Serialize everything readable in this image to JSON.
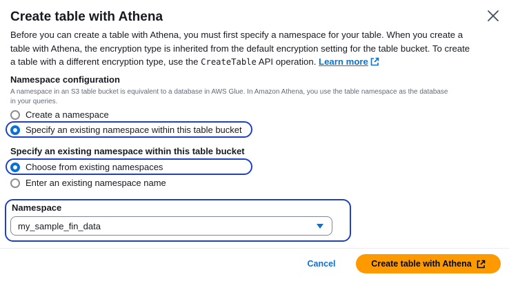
{
  "dialog": {
    "title": "Create table with Athena",
    "intro_line1": "Before you can create a table with Athena, you must first specify a namespace for your table. When you create a",
    "intro_line2": "table with Athena, the encryption type is inherited from the default encryption setting for the table bucket. To create",
    "intro_line3_pre": "a table with a different encryption type, use the ",
    "intro_code": "CreateTable",
    "intro_line3_post": " API operation. ",
    "learn_more": "Learn more"
  },
  "namespace_config": {
    "label": "Namespace configuration",
    "description_line1": "A namespace in an S3 table bucket is equivalent to a database in AWS Glue. In Amazon Athena, you use the table namespace as the database",
    "description_line2": "in your queries.",
    "options": [
      {
        "label": "Create a namespace",
        "selected": false
      },
      {
        "label": "Specify an existing namespace within this table bucket",
        "selected": true
      }
    ]
  },
  "existing_namespace": {
    "label": "Specify an existing namespace within this table bucket",
    "options": [
      {
        "label": "Choose from existing namespaces",
        "selected": true
      },
      {
        "label": "Enter an existing namespace name",
        "selected": false
      }
    ]
  },
  "namespace_field": {
    "label": "Namespace",
    "value": "my_sample_fin_data"
  },
  "footer": {
    "cancel_label": "Cancel",
    "create_label": "Create table with Athena"
  },
  "colors": {
    "link": "#0972d3",
    "primary_button": "#ff9900",
    "highlight_outline": "#1d3fc5"
  },
  "icons": {
    "close": "close-icon",
    "external_link": "external-link-icon",
    "select_caret": "caret-down-icon"
  }
}
